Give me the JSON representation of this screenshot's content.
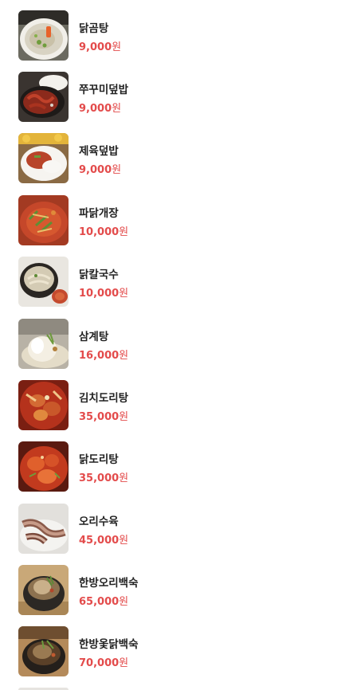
{
  "currency_suffix": "원",
  "price_color": "#e34b4b",
  "menu": [
    {
      "name": "닭곰탕",
      "price": "9,000",
      "image": "dakgomtang-photo"
    },
    {
      "name": "쭈꾸미덮밥",
      "price": "9,000",
      "image": "jjukkumi-deopbap-photo"
    },
    {
      "name": "제육덮밥",
      "price": "9,000",
      "image": "jeyuk-deopbap-photo"
    },
    {
      "name": "파닭개장",
      "price": "10,000",
      "image": "padak-gaejang-photo"
    },
    {
      "name": "닭칼국수",
      "price": "10,000",
      "image": "dak-kalguksu-photo"
    },
    {
      "name": "삼계탕",
      "price": "16,000",
      "image": "samgyetang-photo"
    },
    {
      "name": "김치도리탕",
      "price": "35,000",
      "image": "kimchi-doritang-photo"
    },
    {
      "name": "닭도리탕",
      "price": "35,000",
      "image": "dak-doritang-photo"
    },
    {
      "name": "오리수육",
      "price": "45,000",
      "image": "ori-suyuk-photo"
    },
    {
      "name": "한방오리백숙",
      "price": "65,000",
      "image": "hanbang-ori-baeksuk-photo"
    },
    {
      "name": "한방옻닭백숙",
      "price": "70,000",
      "image": "hanbang-otdak-baeksuk-photo"
    }
  ]
}
